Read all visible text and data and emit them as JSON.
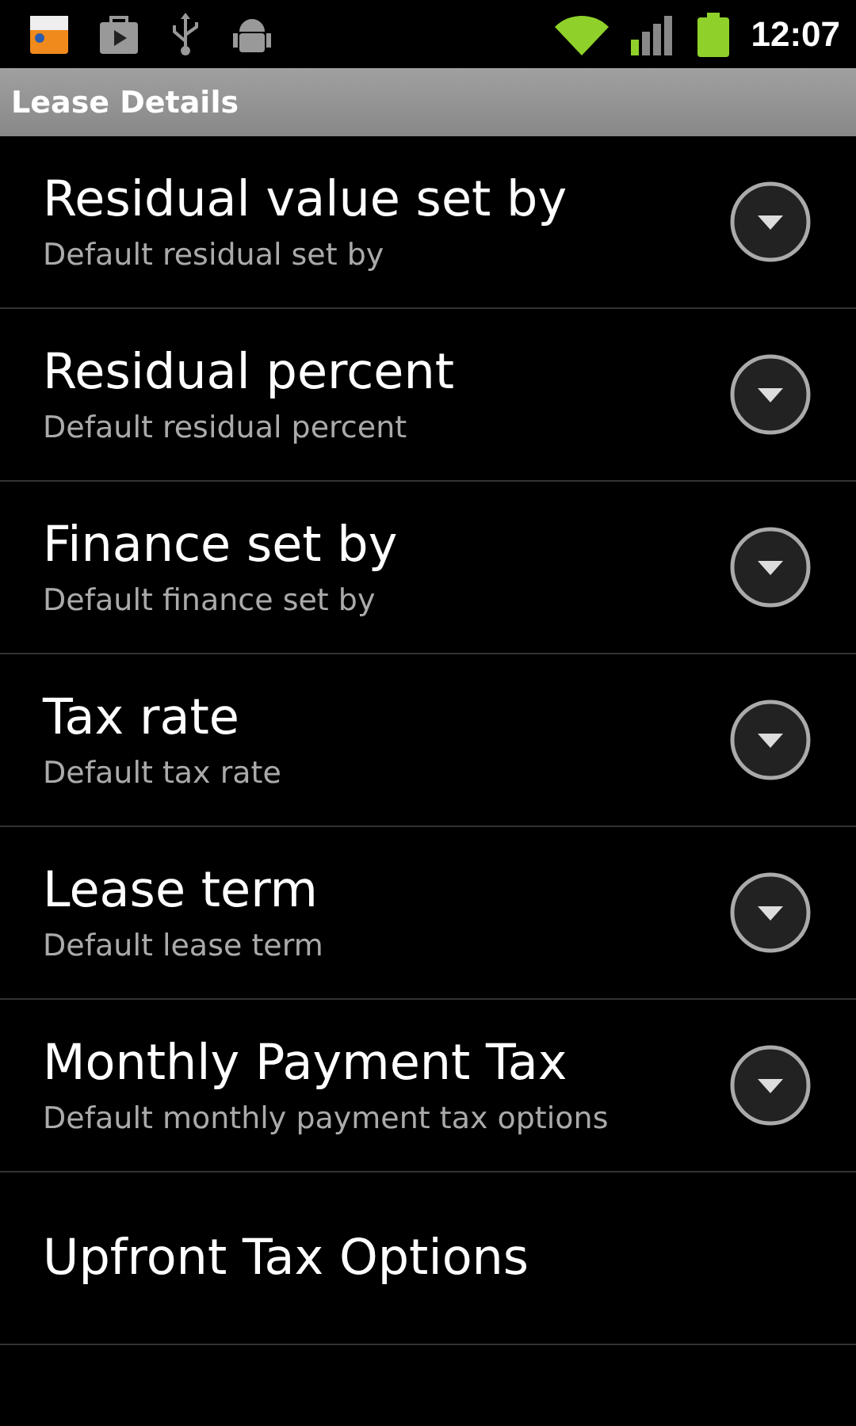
{
  "status_bar": {
    "time": "12:07"
  },
  "title_bar": {
    "title": "Lease Details"
  },
  "preferences": [
    {
      "kind": "dropdown",
      "title": "Residual value set by",
      "summary": "Default residual set by"
    },
    {
      "kind": "dropdown",
      "title": "Residual percent",
      "summary": "Default residual percent"
    },
    {
      "kind": "dropdown",
      "title": "Finance set by",
      "summary": "Default finance set by"
    },
    {
      "kind": "dropdown",
      "title": "Tax rate",
      "summary": "Default tax rate"
    },
    {
      "kind": "dropdown",
      "title": "Lease term",
      "summary": "Default lease term"
    },
    {
      "kind": "dropdown",
      "title": "Monthly Payment Tax",
      "summary": "Default monthly payment tax options"
    },
    {
      "kind": "screen",
      "title": "Upfront Tax Options"
    }
  ]
}
